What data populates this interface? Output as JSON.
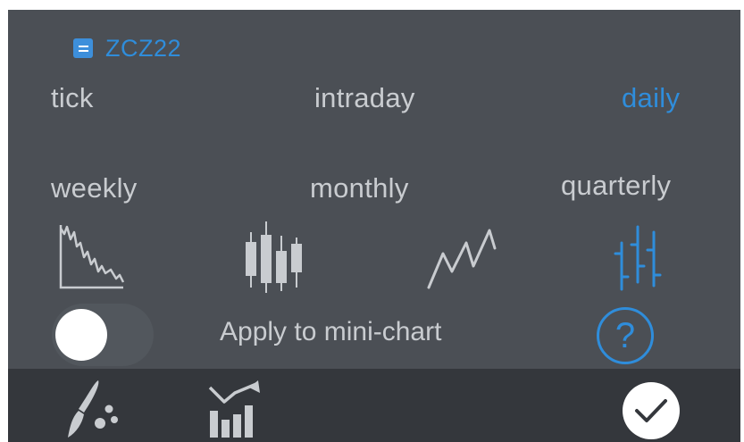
{
  "header": {
    "symbol": "ZCZ22",
    "icon": "document-icon"
  },
  "periods": {
    "tick": "tick",
    "intraday": "intraday",
    "daily": "daily",
    "weekly": "weekly",
    "monthly": "monthly",
    "quarterly": "quarterly",
    "selected": "daily"
  },
  "chart_types": [
    {
      "name": "area",
      "icon": "area-chart-icon"
    },
    {
      "name": "candlestick",
      "icon": "candlestick-chart-icon"
    },
    {
      "name": "line",
      "icon": "line-chart-icon"
    },
    {
      "name": "ohlc-bar",
      "icon": "ohlc-bar-chart-icon",
      "selected": true
    }
  ],
  "mini_chart": {
    "label": "Apply to mini-chart",
    "enabled": false
  },
  "help": {
    "glyph": "?"
  },
  "toolbar": {
    "items": [
      {
        "icon": "paintbrush-icon"
      },
      {
        "icon": "chart-trend-icon"
      },
      {
        "icon": "checkmark-icon"
      }
    ]
  },
  "colors": {
    "accent": "#2f8ddb",
    "panel": "#4b4f55",
    "bottom_bar": "#34373c",
    "text": "#c9ccd0"
  }
}
